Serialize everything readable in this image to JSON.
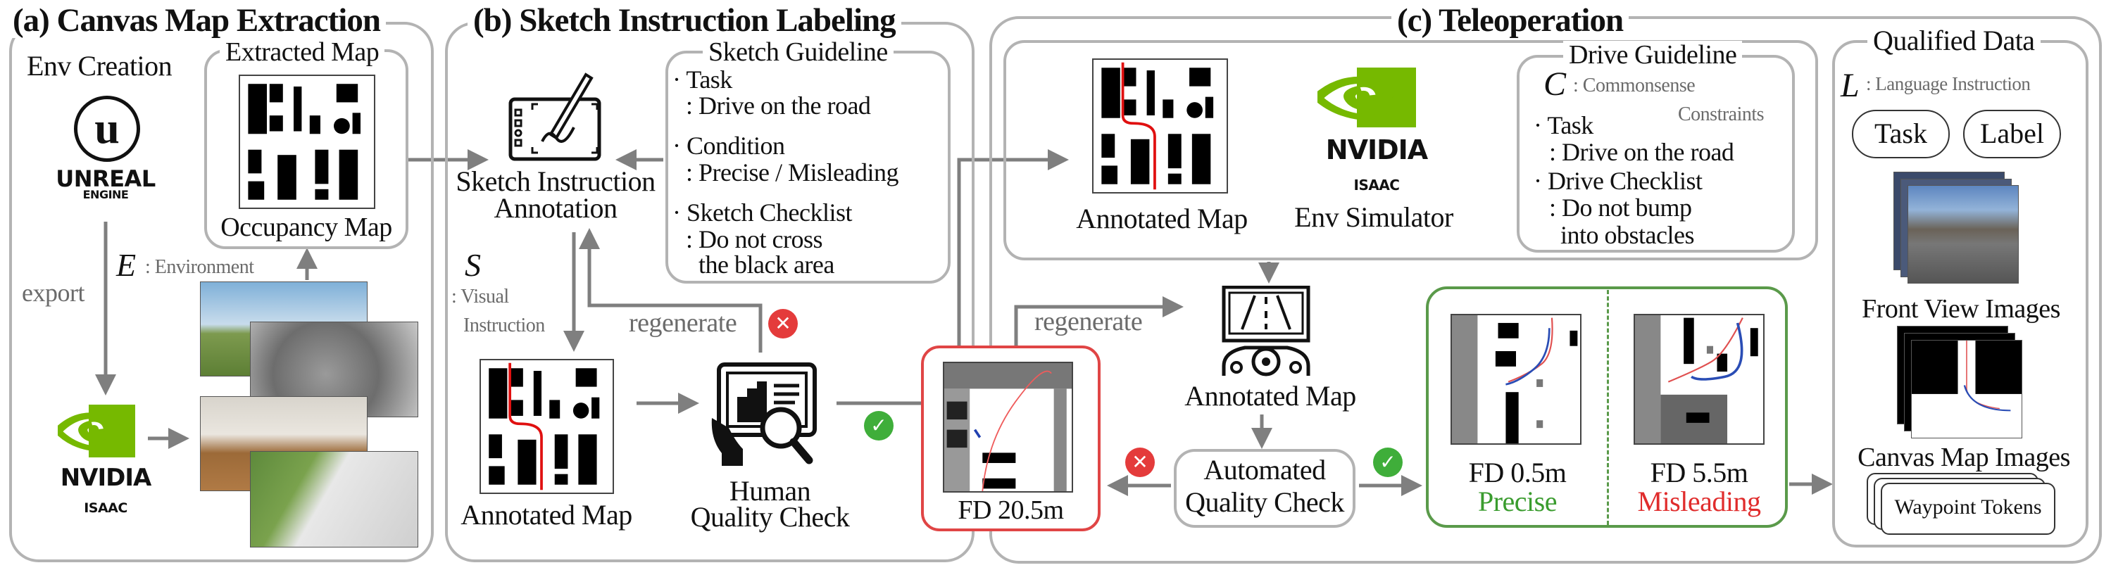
{
  "panel_a": {
    "title": "(a) Canvas Map Extraction",
    "env_creation": "Env Creation",
    "unreal_logo": {
      "line1": "UNREAL",
      "line2": "ENGINE"
    },
    "extracted_map_title": "Extracted Map",
    "occupancy_map": "Occupancy Map",
    "e_symbol": "E",
    "e_label": ": Environment",
    "export": "export",
    "nvidia_logo": {
      "brand": "NVIDIA",
      "product": "ISAAC"
    }
  },
  "panel_b": {
    "title": "(b) Sketch Instruction Labeling",
    "annotation_line1": "Sketch Instruction",
    "annotation_line2": "Annotation",
    "guideline": {
      "title": "Sketch Guideline",
      "items": [
        {
          "head": "Task",
          "body": [
            ": Drive on the road"
          ]
        },
        {
          "head": "Condition",
          "body": [
            ": Precise / Misleading"
          ]
        },
        {
          "head": "Sketch Checklist",
          "body": [
            ": Do not cross",
            "the black area"
          ]
        }
      ]
    },
    "s_symbol": "S",
    "s_label_line1": ": Visual",
    "s_label_line2": "Instruction",
    "regenerate": "regenerate",
    "annotated_map": "Annotated Map",
    "human_check_line1": "Human",
    "human_check_line2": "Quality Check"
  },
  "rejected": {
    "fd": "FD 20.5m"
  },
  "panel_c": {
    "title": "(c) Teleoperation",
    "annotated_map": "Annotated Map",
    "env_simulator": "Env Simulator",
    "nvidia_logo": {
      "brand": "NVIDIA",
      "product": "ISAAC"
    },
    "drive_guideline": {
      "title": "Drive Guideline",
      "c_symbol": "C",
      "c_label_line1": ": Commonsense",
      "c_label_line2": "Constraints",
      "items": [
        {
          "head": "Task",
          "body": [
            ": Drive on the road"
          ]
        },
        {
          "head": "Drive Checklist",
          "body": [
            ": Do not bump",
            "into obstacles"
          ]
        }
      ]
    },
    "teleop_annotated_map": "Annotated Map",
    "regenerate": "regenerate",
    "auto_check_line1": "Automated",
    "auto_check_line2": "Quality Check",
    "results": [
      {
        "fd": "FD 0.5m",
        "label": "Precise",
        "color": "#3a9c2e"
      },
      {
        "fd": "FD 5.5m",
        "label": "Misleading",
        "color": "#e02c2c"
      }
    ]
  },
  "qualified": {
    "title": "Qualified Data",
    "l_symbol": "L",
    "l_label": ": Language Instruction",
    "pills": [
      "Task",
      "Label"
    ],
    "front_view": "Front View Images",
    "canvas_map": "Canvas Map Images",
    "tokens": "Waypoint Tokens"
  },
  "colors": {
    "nvidia_green": "#76b900",
    "reject_red": "#e43b3b",
    "accept_green": "#3fae3a",
    "box_green": "#5a9a4a",
    "connector": "#7f7f7f"
  },
  "icons": [
    "unreal-logo",
    "nvidia-logo",
    "sketch-tablet-icon",
    "quality-check-icon",
    "steering-wheel-icon",
    "reject-x-icon",
    "accept-check-icon"
  ]
}
